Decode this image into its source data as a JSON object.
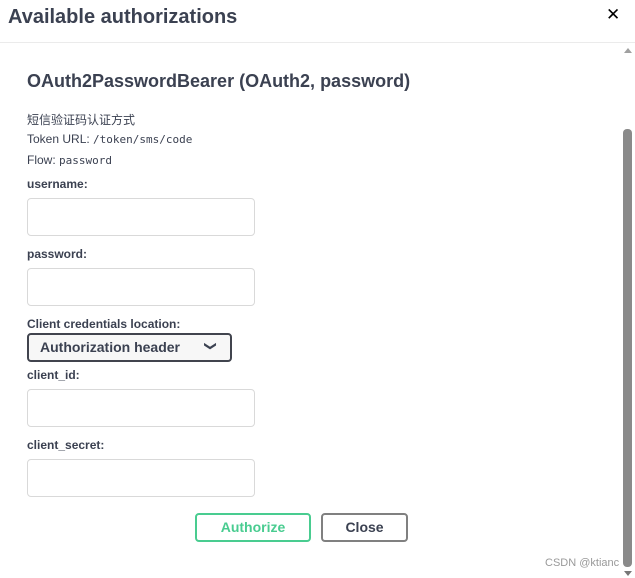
{
  "header": {
    "title": "Available authorizations",
    "close_icon": "close-x-icon"
  },
  "scheme": {
    "title": "OAuth2PasswordBearer (OAuth2, password)",
    "description": "短信验证码认证方式",
    "token_url_label": "Token URL:",
    "token_url": "/token/sms/code",
    "flow_label": "Flow:",
    "flow": "password"
  },
  "form": {
    "username_label": "username:",
    "username_value": "",
    "password_label": "password:",
    "password_value": "",
    "client_location_label": "Client credentials location:",
    "client_location_value": "Authorization header",
    "client_id_label": "client_id:",
    "client_id_value": "",
    "client_secret_label": "client_secret:",
    "client_secret_value": ""
  },
  "buttons": {
    "authorize": "Authorize",
    "close": "Close"
  },
  "colors": {
    "accent": "#49cc90",
    "text": "#3b4151"
  },
  "watermark": "CSDN @ktianc"
}
